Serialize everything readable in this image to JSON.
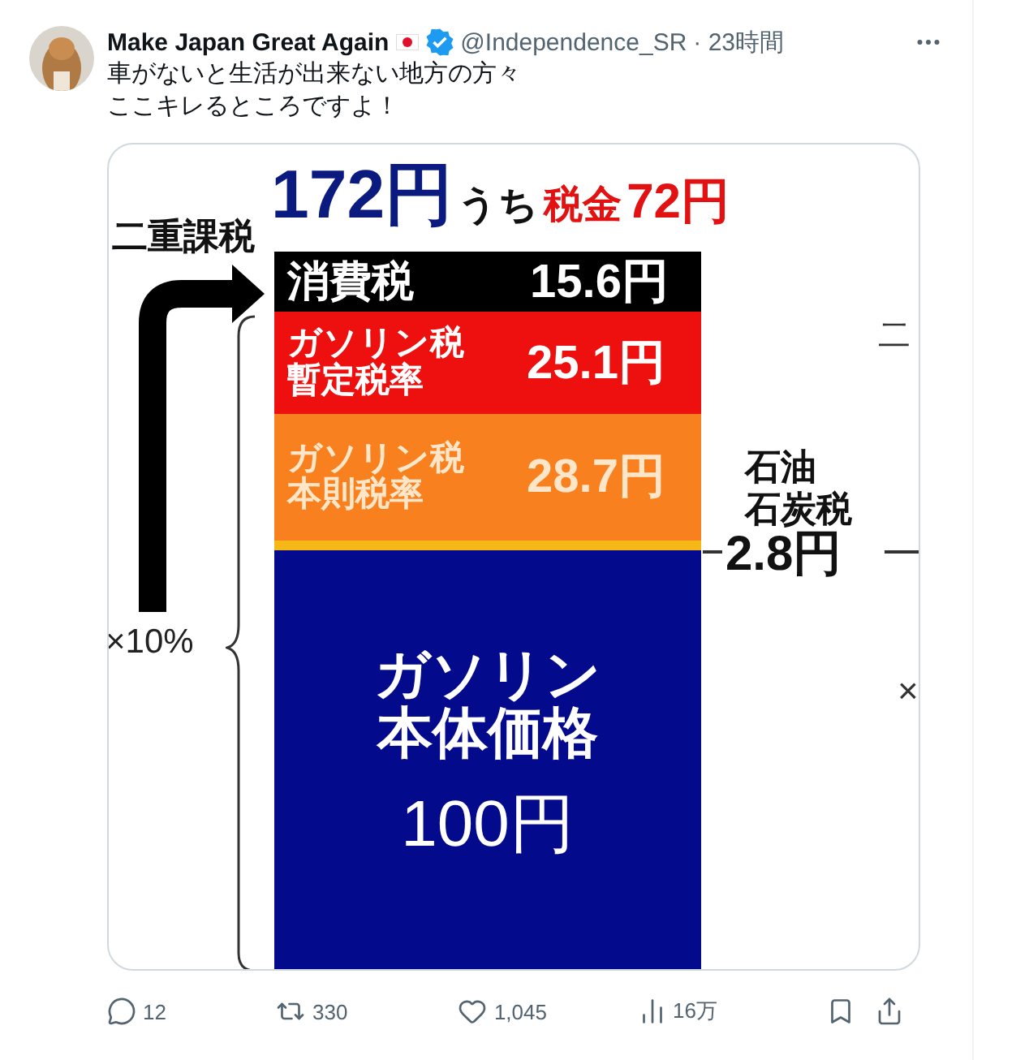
{
  "post": {
    "author": {
      "name": "Make Japan Great Again",
      "handle": "@Independence_SR",
      "time": "· 23時間",
      "verified": true
    },
    "text": [
      "車がないと生活が出来ない地方の方々",
      "ここキレるところですよ！"
    ],
    "image": {
      "total": "172円",
      "between": "うち",
      "tax_label": "税金",
      "tax_amount": "72円",
      "left_label": "二重課税",
      "multiplier": "×10%",
      "segments": [
        {
          "kind": "label",
          "lines": [
            "消費税"
          ],
          "amount": "15.6円",
          "color": "#000000"
        },
        {
          "kind": "label",
          "lines": [
            "ガソリン税",
            "暫定税率"
          ],
          "amount": "25.1円",
          "color": "#ee0f0f"
        },
        {
          "kind": "label",
          "lines": [
            "ガソリン税",
            "本則税率"
          ],
          "amount": "28.7円",
          "color": "#f9801f"
        },
        {
          "kind": "strip",
          "color": "#f6b816"
        },
        {
          "kind": "base",
          "lines": [
            "ガソリン",
            "本体価格"
          ],
          "amount": "100円",
          "color": "#040a8c"
        }
      ],
      "side_label": [
        "石油",
        "石炭税"
      ],
      "side_amount": "2.8円",
      "edge_fragments": [
        "二",
        "×"
      ]
    },
    "actions": [
      {
        "kind": "reply",
        "count": "12"
      },
      {
        "kind": "repost",
        "count": "330"
      },
      {
        "kind": "like",
        "count": "1,045"
      },
      {
        "kind": "views",
        "count": "16万"
      },
      {
        "kind": "bookmark"
      },
      {
        "kind": "share"
      }
    ]
  }
}
